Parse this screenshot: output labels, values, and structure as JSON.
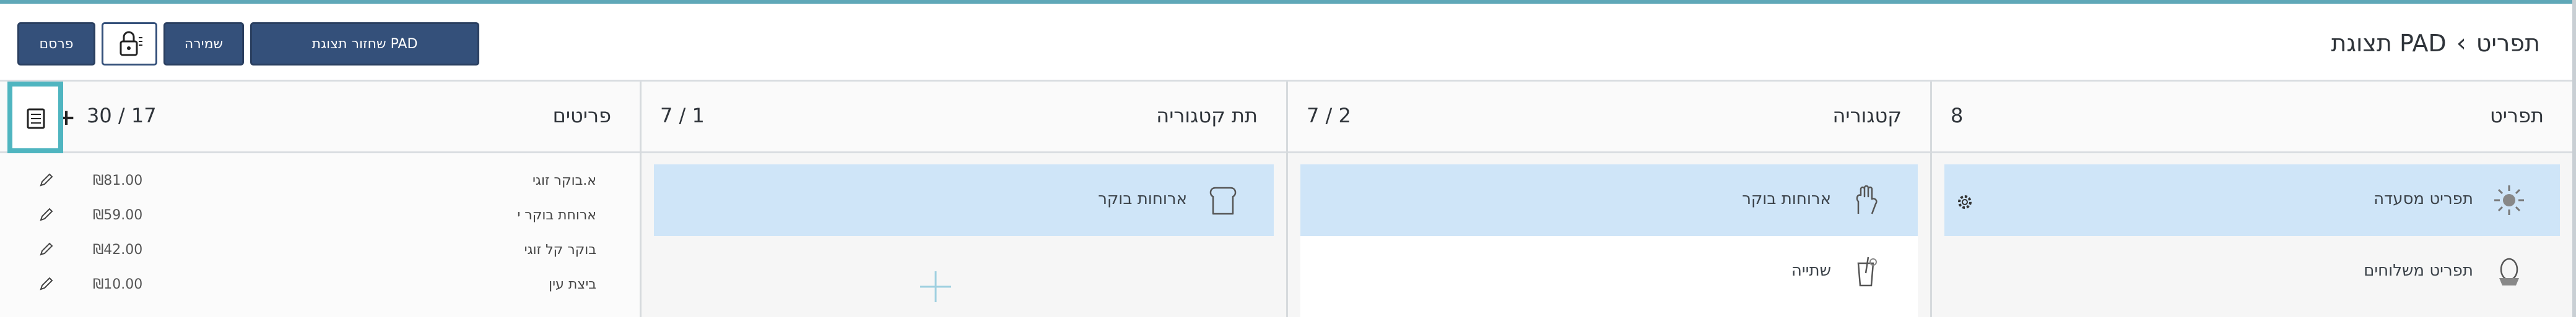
{
  "header": {
    "breadcrumb": [
      "תפריט",
      "תצוגת PAD"
    ],
    "buttons": {
      "publish": "פרסם",
      "save": "שמירה",
      "reset_pad_view": "שחזור תצוגת PAD"
    }
  },
  "columns": {
    "menu": {
      "title": "תפריט",
      "count": "8",
      "items": [
        {
          "label": "תפריט מסעדה",
          "icon": "sun-icon",
          "selected": true
        },
        {
          "label": "תפריט משלוחים",
          "icon": "egg-icon",
          "selected": false
        }
      ]
    },
    "category": {
      "title": "קטגוריה",
      "count": "7 / 2",
      "items": [
        {
          "label": "ארוחות בוקר",
          "icon": "hand-icon",
          "selected": true
        },
        {
          "label": "שתייה",
          "icon": "cup-icon",
          "selected": false
        }
      ]
    },
    "subcategory": {
      "title": "תת קטגוריה",
      "count": "7 / 1",
      "items": [
        {
          "label": "ארוחות בוקר",
          "icon": "bread-icon",
          "selected": true
        }
      ]
    },
    "items": {
      "title": "פריטים",
      "count": "30 / 17",
      "rows": [
        {
          "name": "א.בוקר זוגי",
          "price": "₪81.00"
        },
        {
          "name": "ארוחת בוקר י",
          "price": "₪59.00"
        },
        {
          "name": "בוקר קל זוגי",
          "price": "₪42.00"
        },
        {
          "name": "ביצת עין",
          "price": "₪10.00"
        }
      ]
    }
  },
  "colors": {
    "accent": "#5fa8b8",
    "button": "#34507a",
    "selected": "#cfe5f8",
    "highlight_border": "#4fb5c0"
  }
}
